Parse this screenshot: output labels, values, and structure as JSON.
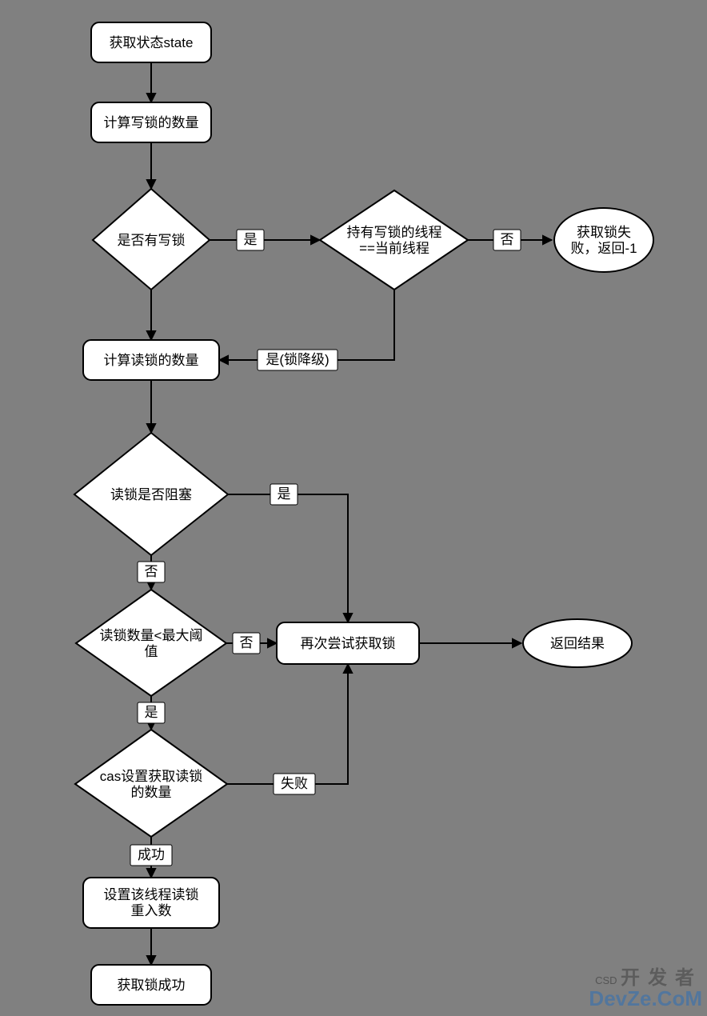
{
  "chart_data": {
    "type": "flowchart",
    "nodes": [
      {
        "id": "n1",
        "shape": "rect",
        "label": "获取状态state"
      },
      {
        "id": "n2",
        "shape": "rect",
        "label": "计算写锁的数量"
      },
      {
        "id": "n3",
        "shape": "diamond",
        "label": "是否有写锁"
      },
      {
        "id": "n4",
        "shape": "diamond",
        "label": "持有写锁的线程==当前线程"
      },
      {
        "id": "n5",
        "shape": "ellipse",
        "label": "获取锁失败，返回-1"
      },
      {
        "id": "n6",
        "shape": "rect",
        "label": "计算读锁的数量"
      },
      {
        "id": "n7",
        "shape": "diamond",
        "label": "读锁是否阻塞"
      },
      {
        "id": "n8",
        "shape": "diamond",
        "label": "读锁数量<最大阈值"
      },
      {
        "id": "n9",
        "shape": "rect",
        "label": "再次尝试获取锁"
      },
      {
        "id": "n10",
        "shape": "ellipse",
        "label": "返回结果"
      },
      {
        "id": "n11",
        "shape": "diamond",
        "label": "cas设置获取读锁的数量"
      },
      {
        "id": "n12",
        "shape": "rect",
        "label": "设置该线程读锁重入数"
      },
      {
        "id": "n13",
        "shape": "rect",
        "label": "获取锁成功"
      }
    ],
    "edges": [
      {
        "from": "n1",
        "to": "n2",
        "label": ""
      },
      {
        "from": "n2",
        "to": "n3",
        "label": ""
      },
      {
        "from": "n3",
        "to": "n4",
        "label": "是"
      },
      {
        "from": "n4",
        "to": "n5",
        "label": "否"
      },
      {
        "from": "n4",
        "to": "n6",
        "label": "是(锁降级)"
      },
      {
        "from": "n3",
        "to": "n6",
        "label": ""
      },
      {
        "from": "n6",
        "to": "n7",
        "label": ""
      },
      {
        "from": "n7",
        "to": "n9",
        "label": "是"
      },
      {
        "from": "n7",
        "to": "n8",
        "label": "否"
      },
      {
        "from": "n8",
        "to": "n9",
        "label": "否"
      },
      {
        "from": "n8",
        "to": "n11",
        "label": "是"
      },
      {
        "from": "n11",
        "to": "n9",
        "label": "失败"
      },
      {
        "from": "n9",
        "to": "n10",
        "label": ""
      },
      {
        "from": "n11",
        "to": "n12",
        "label": "成功"
      },
      {
        "from": "n12",
        "to": "n13",
        "label": ""
      }
    ]
  },
  "nodes": {
    "n1": "获取状态state",
    "n2": "计算写锁的数量",
    "n3": "是否有写锁",
    "n4a": "持有写锁的线程",
    "n4b": "==当前线程",
    "n5a": "获取锁失",
    "n5b": "败，返回-1",
    "n6": "计算读锁的数量",
    "n7": "读锁是否阻塞",
    "n8a": "读锁数量<最大阈",
    "n8b": "值",
    "n9": "再次尝试获取锁",
    "n10": "返回结果",
    "n11a": "cas设置获取读锁",
    "n11b": "的数量",
    "n12a": "设置该线程读锁",
    "n12b": "重入数",
    "n13": "获取锁成功"
  },
  "labels": {
    "e3_4": "是",
    "e4_5": "否",
    "e4_6": "是(锁降级)",
    "e7_9": "是",
    "e7_8": "否",
    "e8_9": "否",
    "e8_11": "是",
    "e11_9": "失败",
    "e11_12": "成功"
  },
  "watermark": {
    "tiny": "CSD",
    "top": "开发者",
    "bottom": "DevZe.CoM"
  }
}
